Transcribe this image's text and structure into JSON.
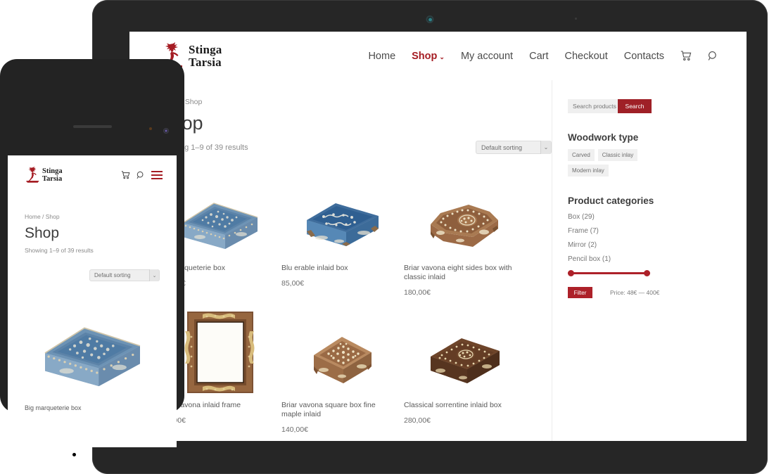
{
  "site": {
    "logo_line1": "Stinga",
    "logo_line2": "Tarsia",
    "logo_icon": "stinga-dancer-logo"
  },
  "nav": {
    "items": [
      {
        "label": "Home",
        "active": false,
        "caret": false
      },
      {
        "label": "Shop",
        "active": true,
        "caret": true
      },
      {
        "label": "My account",
        "active": false,
        "caret": false
      },
      {
        "label": "Cart",
        "active": false,
        "caret": false
      },
      {
        "label": "Checkout",
        "active": false,
        "caret": false
      },
      {
        "label": "Contacts",
        "active": false,
        "caret": false
      }
    ],
    "caret_glyph": "⌄",
    "cart_icon": "cart-icon",
    "search_icon": "search-icon"
  },
  "page": {
    "breadcrumb": "Home / Shop",
    "title": "Shop",
    "result_count": "Showing 1–9 of 39 results",
    "sorting_value": "Default sorting",
    "sorting_arrow": "⌄"
  },
  "products": [
    {
      "title": "Big marqueterie box",
      "price": "400,00€",
      "image": "blue-marquetry-box"
    },
    {
      "title": "Blu erable inlaid box",
      "price": "85,00€",
      "image": "dark-blue-inlaid-box"
    },
    {
      "title": "Briar vavona eight sides box with classic inlaid",
      "price": "180,00€",
      "image": "briar-octagonal-box"
    },
    {
      "title": "Briar vavona inlaid frame",
      "price": "160,00€",
      "image": "inlaid-wooden-frame"
    },
    {
      "title": "Briar vavona square box fine maple inlaid",
      "price": "140,00€",
      "image": "square-inlaid-box"
    },
    {
      "title": "Classical sorrentine inlaid box",
      "price": "280,00€",
      "image": "sorrentine-inlaid-box"
    }
  ],
  "sidebar": {
    "search_placeholder": "Search products",
    "search_button": "Search",
    "woodwork": {
      "title": "Woodwork type",
      "tags": [
        "Carved",
        "Classic inlay",
        "Modern inlay"
      ]
    },
    "categories": {
      "title": "Product categories",
      "items": [
        "Box (29)",
        "Frame (7)",
        "Mirror (2)",
        "Pencil box (1)"
      ]
    },
    "filter": {
      "button": "Filter",
      "price_label": "Price: 48€ — 400€"
    }
  },
  "colors": {
    "brand_red": "#a51c23",
    "button_red": "#ad2129",
    "search_red": "#9f2027",
    "text_dark": "#3d3d3d",
    "text_muted": "#8b8b8b",
    "device_dark": "#262626"
  }
}
